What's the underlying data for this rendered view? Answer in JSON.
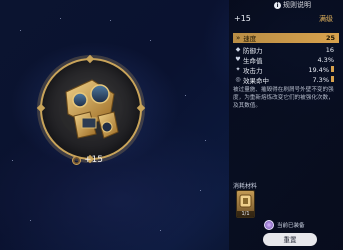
{
  "header": {
    "info_label": "规则说明",
    "info_icon": "info-icon"
  },
  "relic": {
    "level_label": "+15",
    "coin_icon": "coin-icon"
  },
  "panel": {
    "level": "+15",
    "max_label": "满级",
    "main_stat": {
      "name": "速度",
      "value": "25",
      "icon": "speed-icon"
    },
    "sub_stats": [
      {
        "name": "防御力",
        "value": "16",
        "icon": "shield-icon"
      },
      {
        "name": "生命值",
        "value": "4.3%",
        "icon": "heart-icon"
      },
      {
        "name": "攻击力",
        "value": "19.4%",
        "icon": "sword-icon"
      },
      {
        "name": "效果命中",
        "value": "7.3%",
        "icon": "target-icon"
      }
    ],
    "description": "被过量施、摧毁得在刷屑号外壁不变的强度，为重新熔炼改变它们的被强化次数，及其数值。",
    "materials_title": "消耗材料",
    "material_count": "1/1",
    "equipped_label": "当前已装备",
    "reset_button": "重置"
  },
  "colors": {
    "gold": "#d8a24d",
    "accent_orange": "#e2b35c",
    "panel_bg": "#0b1020"
  }
}
